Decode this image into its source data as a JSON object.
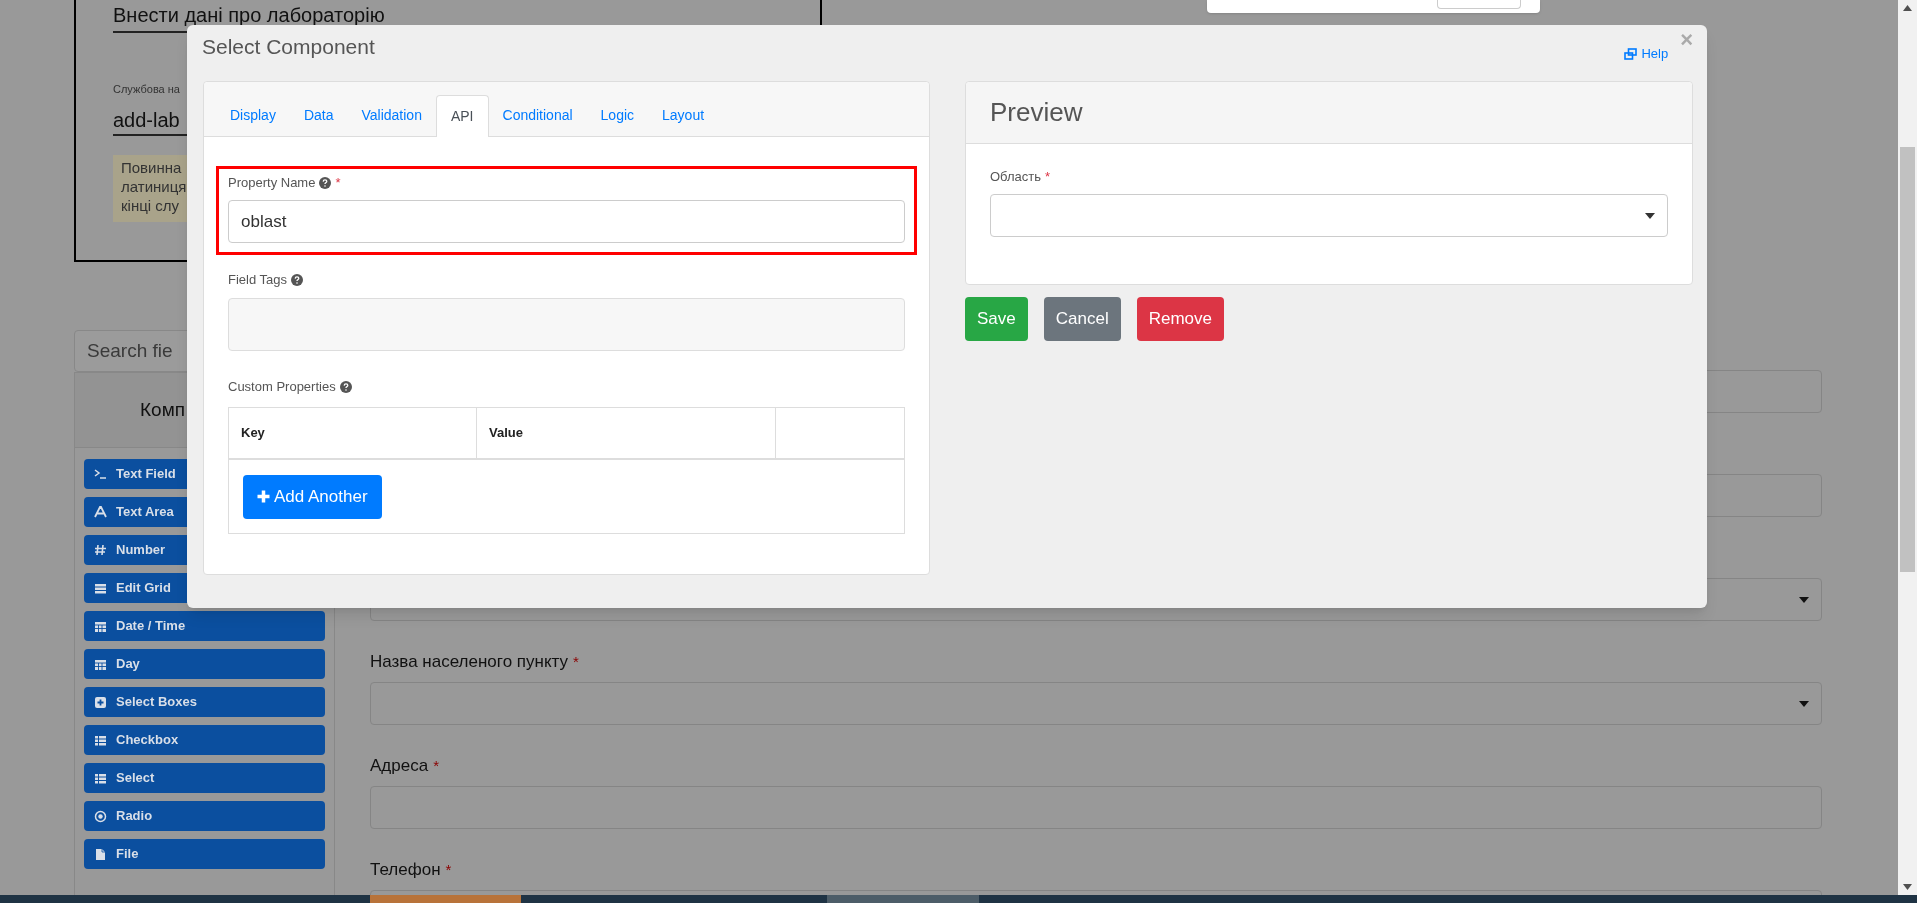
{
  "page": {
    "heading": "Внести дані про лабораторію",
    "service_name_label": "Службова на",
    "service_name_value": "add-lab",
    "note_lines": [
      "Повинна",
      "латиниця",
      "кінці слу"
    ],
    "search": {
      "placeholder": "Search fie"
    },
    "components_heading": "Комп",
    "components": [
      {
        "kind": "textfield",
        "label": "Text Field"
      },
      {
        "kind": "textarea",
        "label": "Text Area"
      },
      {
        "kind": "number",
        "label": "Number"
      },
      {
        "kind": "editgrid",
        "label": "Edit Grid"
      },
      {
        "kind": "datetime",
        "label": "Date / Time"
      },
      {
        "kind": "day",
        "label": "Day"
      },
      {
        "kind": "selectboxes",
        "label": "Select Boxes"
      },
      {
        "kind": "checkbox",
        "label": "Checkbox"
      },
      {
        "kind": "select",
        "label": "Select"
      },
      {
        "kind": "radio",
        "label": "Radio"
      },
      {
        "kind": "file",
        "label": "File"
      }
    ],
    "form_fields": [
      {
        "kind": "input"
      },
      {
        "kind": "input"
      },
      {
        "kind": "select"
      },
      {
        "kind": "select",
        "label": "Назва населеного пункту",
        "required_mark": "*"
      },
      {
        "kind": "input",
        "label": "Адреса",
        "required_mark": "*"
      },
      {
        "kind": "input",
        "label": "Телефон",
        "required_mark": "*"
      }
    ]
  },
  "modal": {
    "title": "Select Component",
    "help": "Help",
    "close": "×",
    "tabs": [
      {
        "label": "Display",
        "selected": false
      },
      {
        "label": "Data",
        "selected": false
      },
      {
        "label": "Validation",
        "selected": false
      },
      {
        "label": "API",
        "selected": true
      },
      {
        "label": "Conditional",
        "selected": false
      },
      {
        "label": "Logic",
        "selected": false
      },
      {
        "label": "Layout",
        "selected": false
      }
    ],
    "property_name": {
      "label": "Property Name",
      "required_mark": "*",
      "value": "oblast"
    },
    "field_tags": {
      "label": "Field Tags"
    },
    "custom_properties": {
      "label": "Custom Properties",
      "columns": [
        "Key",
        "Value"
      ],
      "add_button": "Add Another"
    },
    "preview": {
      "title": "Preview",
      "field_label": "Область",
      "required_mark": "*"
    },
    "buttons": [
      {
        "kind": "save",
        "label": "Save"
      },
      {
        "kind": "cancel",
        "label": "Cancel"
      },
      {
        "kind": "remove",
        "label": "Remove"
      }
    ]
  }
}
